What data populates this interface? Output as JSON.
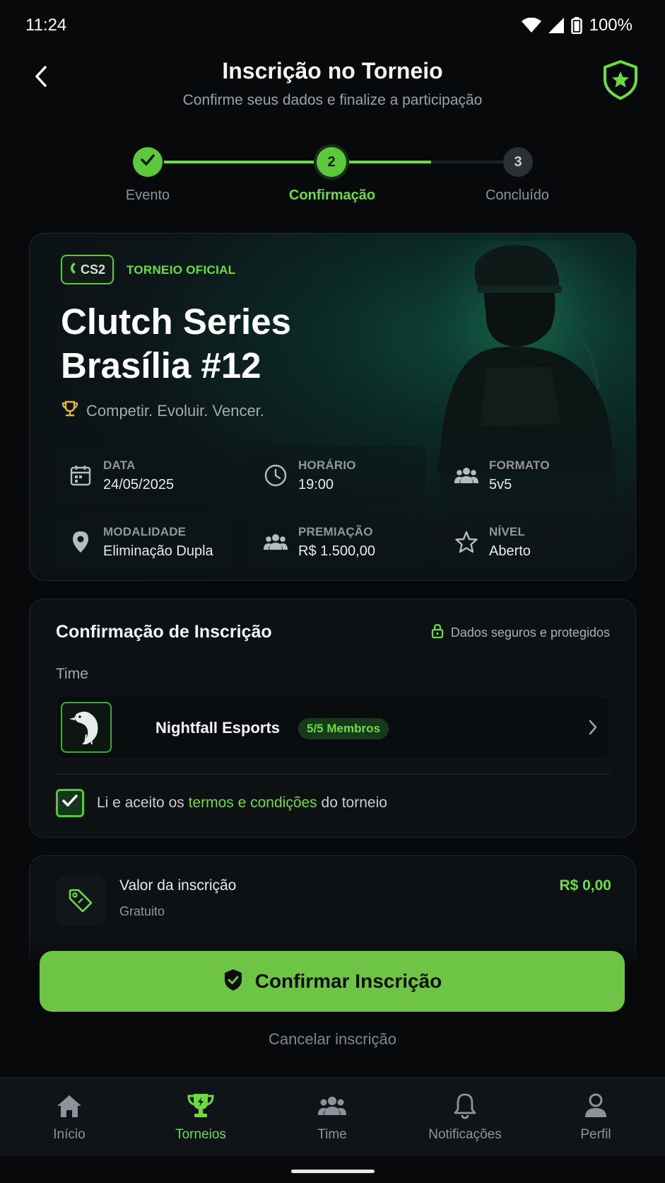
{
  "status_bar": {
    "time": "11:24",
    "battery": "100%"
  },
  "header": {
    "title": "Inscrição no Torneio",
    "subtitle": "Confirme seus dados e finalize a participação"
  },
  "stepper": {
    "steps": [
      {
        "number": "1",
        "label": "Evento",
        "state": "done"
      },
      {
        "number": "2",
        "label": "Confirmação",
        "state": "current"
      },
      {
        "number": "3",
        "label": "Concluído",
        "state": "pending"
      }
    ]
  },
  "event": {
    "game_badge": "CS2",
    "official_label": "TORNEIO OFICIAL",
    "title_line1": "Clutch Series",
    "title_line2": "Brasília #12",
    "tagline": "Competir. Evoluir. Vencer.",
    "info": [
      {
        "icon": "calendar-icon",
        "label": "DATA",
        "value": "24/05/2025"
      },
      {
        "icon": "clock-icon",
        "label": "HORÁRIO",
        "value": "19:00"
      },
      {
        "icon": "users-icon",
        "label": "FORMATO",
        "value": "5v5"
      },
      {
        "icon": "location-pin-icon",
        "label": "MODALIDADE",
        "value": "Eliminação Dupla"
      },
      {
        "icon": "users-icon",
        "label": "PREMIAÇÃO",
        "value": "R$ 1.500,00"
      },
      {
        "icon": "star-icon",
        "label": "NÍVEL",
        "value": "Aberto"
      }
    ]
  },
  "confirmation": {
    "title": "Confirmação de Inscrição",
    "secure_label": "Dados seguros e protegidos",
    "team_label": "Time",
    "team_name": "Nightfall Esports",
    "members": "5/5 Membros",
    "terms_prefix": "Li e aceito os",
    "terms_link": "termos e condições",
    "terms_suffix": "do torneio",
    "terms_checked": true
  },
  "fee": {
    "label": "Valor da inscrição",
    "sublabel": "Gratuito",
    "value": "R$ 0,00"
  },
  "actions": {
    "confirm_label": "Confirmar Inscrição",
    "cancel_label": "Cancelar inscrição"
  },
  "tabbar": {
    "items": [
      {
        "label": "Início",
        "icon": "home-icon"
      },
      {
        "label": "Torneios",
        "icon": "trophy-icon",
        "active": true
      },
      {
        "label": "Time",
        "icon": "team-icon"
      },
      {
        "label": "Notificações",
        "icon": "bell-icon"
      },
      {
        "label": "Perfil",
        "icon": "profile-icon"
      }
    ]
  },
  "colors": {
    "accent": "#6cdc44",
    "cta": "#6ec444",
    "background": "#07090b",
    "card": "#0d1113"
  }
}
